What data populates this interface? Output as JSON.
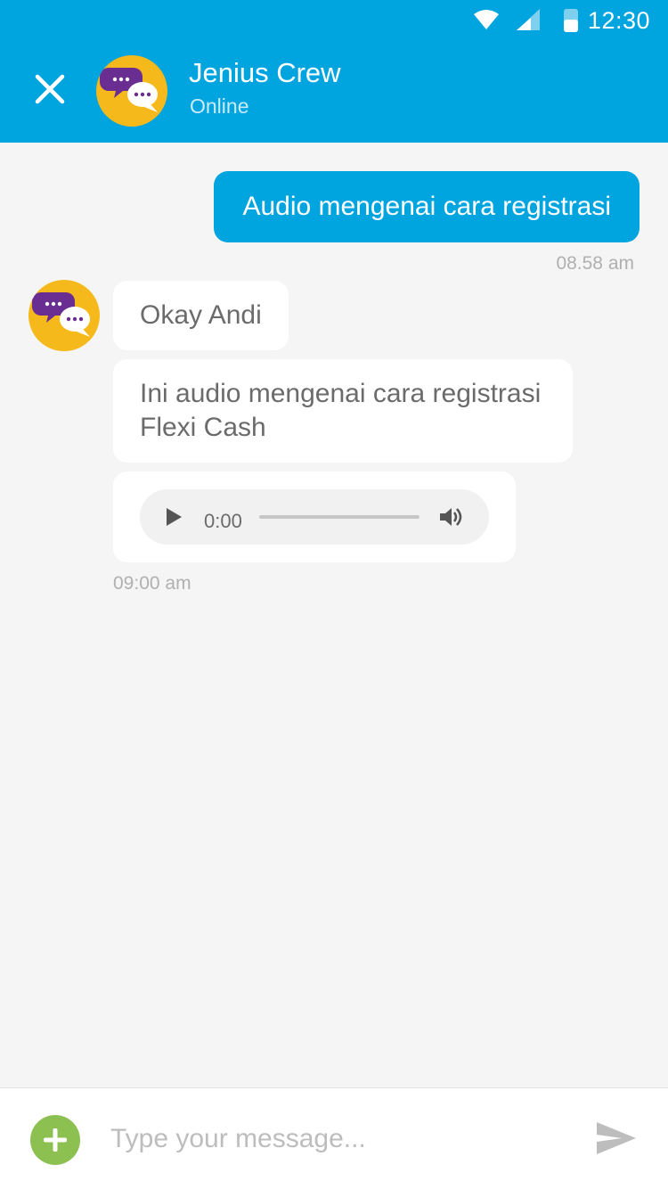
{
  "status_bar": {
    "time": "12:30",
    "icons": [
      "wifi-icon",
      "signal-icon",
      "battery-icon"
    ]
  },
  "header": {
    "close_icon": "close-icon",
    "title": "Jenius Crew",
    "subtitle": "Online",
    "avatar_icon": "chat-bubbles-icon"
  },
  "messages": [
    {
      "direction": "outgoing",
      "text": "Audio mengenai cara registrasi",
      "time": "08.58 am"
    },
    {
      "direction": "incoming",
      "text": "Okay Andi"
    },
    {
      "direction": "incoming",
      "text": "Ini audio mengenai cara registrasi Flexi Cash"
    },
    {
      "direction": "incoming",
      "type": "audio",
      "audio": {
        "current_time": "0:00",
        "progress": 0
      },
      "time": "09:00 am"
    }
  ],
  "composer": {
    "placeholder": "Type your message...",
    "add_icon": "plus-icon",
    "send_icon": "send-icon"
  },
  "colors": {
    "primary": "#00a4df",
    "avatar": "#f6b91b",
    "avatar_bubble": "#6a2d91",
    "add_button": "#8cc152",
    "background": "#f5f5f5"
  }
}
